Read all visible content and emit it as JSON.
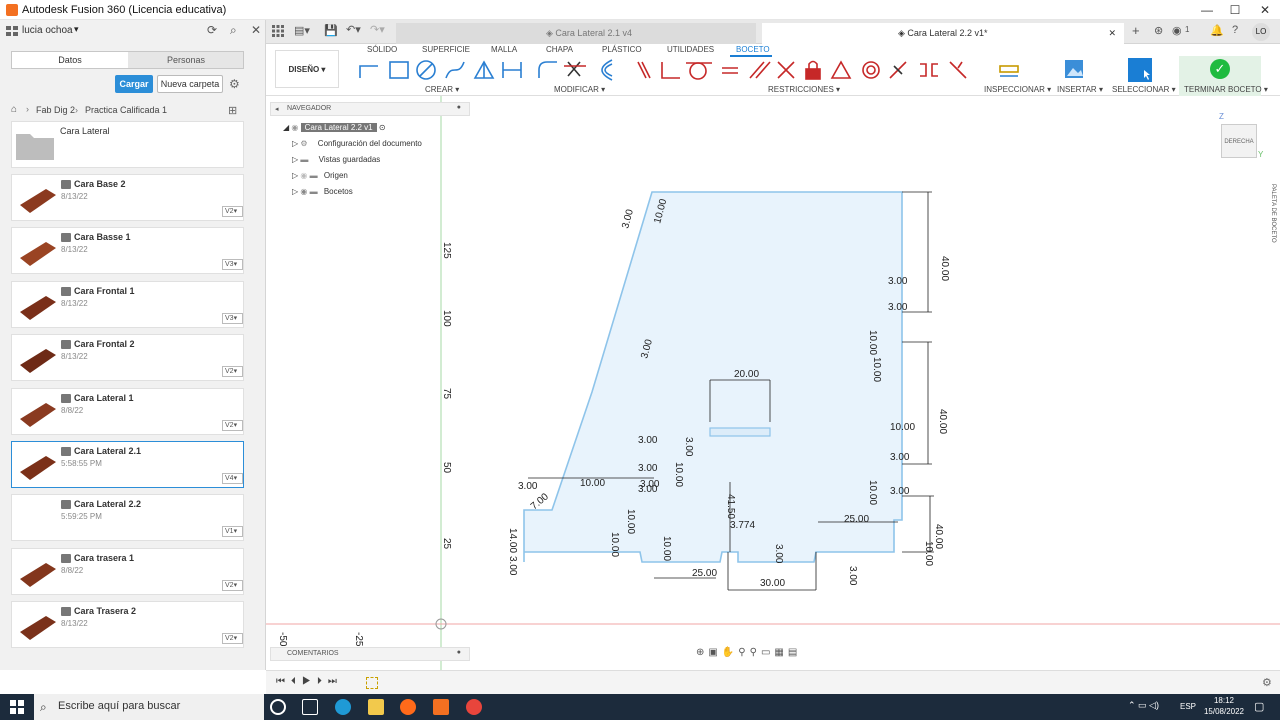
{
  "window": {
    "title": "Autodesk Fusion 360 (Licencia educativa)",
    "minimize": "—",
    "maximize": "☐",
    "close": "✕"
  },
  "data_panel": {
    "user": "lucia ochoa",
    "tabs": [
      "Datos",
      "Personas"
    ],
    "upload_label": "Cargar",
    "new_folder_label": "Nueva carpeta",
    "breadcrumb": [
      "Fab Dig 2",
      "Practica Calificada 1"
    ],
    "folder": {
      "name": "Cara Lateral"
    },
    "items": [
      {
        "name": "Cara Base 2",
        "date": "8/13/22",
        "version": "V2"
      },
      {
        "name": "Cara Basse 1",
        "date": "8/13/22",
        "version": "V3"
      },
      {
        "name": "Cara Frontal 1",
        "date": "8/13/22",
        "version": "V3"
      },
      {
        "name": "Cara Frontal 2",
        "date": "8/13/22",
        "version": "V2"
      },
      {
        "name": "Cara Lateral 1",
        "date": "8/8/22",
        "version": "V2"
      },
      {
        "name": "Cara Lateral 2.1",
        "date": "5:58:55 PM",
        "version": "V4"
      },
      {
        "name": "Cara Lateral 2.2",
        "date": "5:59:25 PM",
        "version": "V1"
      },
      {
        "name": "Cara trasera 1",
        "date": "8/8/22",
        "version": "V2"
      },
      {
        "name": "Cara Trasera 2",
        "date": "8/13/22",
        "version": "V2"
      }
    ]
  },
  "doc_tabs": [
    {
      "label": "Cara Lateral 2.1 v4",
      "active": false
    },
    {
      "label": "Cara Lateral 2.2 v1*",
      "active": true
    }
  ],
  "toolbar": {
    "workspace": "DISEÑO",
    "tabs": [
      "SÓLIDO",
      "SUPERFICIE",
      "MALLA",
      "CHAPA",
      "PLÁSTICO",
      "UTILIDADES",
      "BOCETO"
    ],
    "groups": [
      "CREAR",
      "MODIFICAR",
      "RESTRICCIONES",
      "INSPECCIONAR",
      "INSERTAR",
      "SELECCIONAR",
      "TERMINAR BOCETO"
    ],
    "user_initials": "LO",
    "notifications": "1"
  },
  "browser": {
    "title": "NAVEGADOR",
    "root": "Cara Lateral 2.2 v1",
    "rows": [
      "Configuración del documento",
      "Vistas guardadas",
      "Origen",
      "Bocetos"
    ]
  },
  "viewcube": {
    "face": "DERECHA",
    "z": "Z",
    "y": "Y"
  },
  "sketch_palette": "PALETA DE BOCETO",
  "comments": "COMENTARIOS",
  "axis_ticks": {
    "vertical": [
      "125",
      "100",
      "75",
      "50",
      "25"
    ],
    "horizontal": [
      "-50",
      "-25"
    ]
  },
  "dimensions": [
    "10.00",
    "3.00",
    "40.00",
    "3.00",
    "3.00",
    "10.00",
    "10.00",
    "3.00",
    "20.00",
    "40.00",
    "3.00",
    "3.00",
    "10.00",
    "3.00",
    "3.00",
    "10.00",
    "3.00",
    "10.00",
    "3.00",
    "3.00",
    "10.00",
    "10.00",
    "40.00",
    "3.00",
    "7.00",
    "14.00",
    "3.00",
    "10.00",
    "41.50",
    "3.774",
    "10.00",
    "3.00",
    "25.00",
    "10.00",
    "3.00",
    "25.00",
    "30.00"
  ],
  "taskbar": {
    "search_placeholder": "Escribe aquí para buscar",
    "lang": "ESP",
    "time": "18:12",
    "date": "15/08/2022"
  },
  "colors": {
    "accent": "#2c8ed8",
    "sketch_fill": "#e8f3fc",
    "sketch_line": "#8ec4ea",
    "finish": "#1fbb3f",
    "taskbar": "#1c2b3c"
  }
}
